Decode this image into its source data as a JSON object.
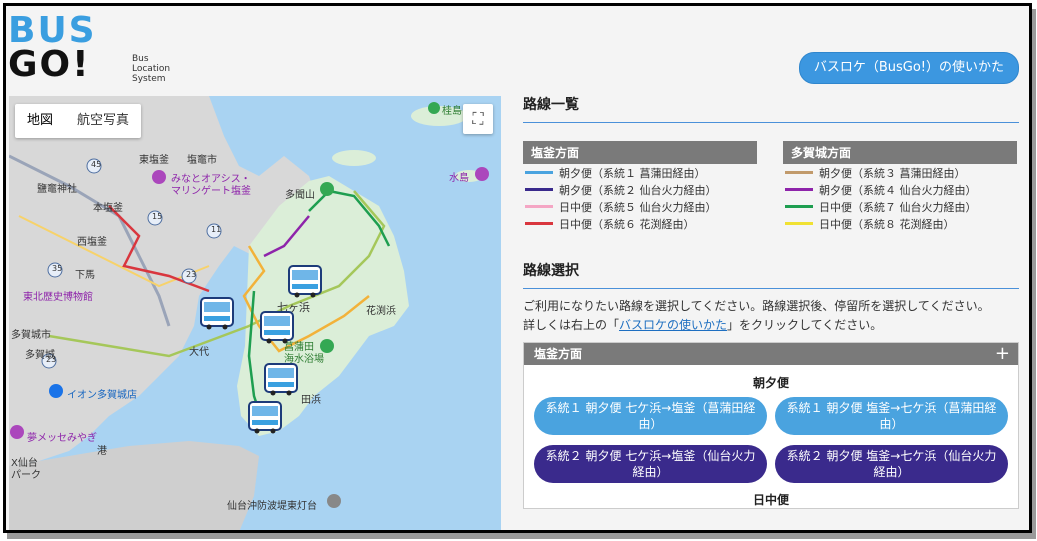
{
  "logo": {
    "big_line1": "BUS",
    "big_line2": "GO!",
    "small": [
      "Bus",
      "Location",
      "System"
    ]
  },
  "header": {
    "help_button": "バスロケ（BusGo!）の使いかた"
  },
  "map": {
    "toggle": [
      "地図",
      "航空写真"
    ],
    "fullscreen_icon": "⛶",
    "labels": {
      "higashishiogama": "東塩釜",
      "shiogamashi": "塩竈市",
      "shiogamajinja": "鹽竈神社",
      "minato_oasis": "みなとオアシス・",
      "marigate": "マリンゲート塩釜",
      "mizushima": "水島",
      "katsurashima": "桂島",
      "tamonzan": "多聞山",
      "honshiogama": "本塩釜",
      "nishishiogama": "西塩釜",
      "shimoma": "下馬",
      "tohoku_museum": "東北歴史博物館",
      "tagajo_city": "多賀城市",
      "tagajo": "多賀城",
      "shichigahama": "七ヶ浜",
      "hanabuchihama": "花渕浜",
      "shobuta": "菖蒲田",
      "kaisuiyokujo": "海水浴場",
      "ohoru": "大代",
      "aeon": "イオン多賀城店",
      "yume_messe": "夢メッセみやぎ",
      "minato": "港",
      "sendaiport": "X仙台",
      "park": "パーク",
      "tahama": "田浜",
      "breakwater": "仙台沖防波堤東灯台",
      "r45": "45",
      "r23a": "23",
      "r23b": "23",
      "r35": "35",
      "r11": "11",
      "r15": "15"
    }
  },
  "route_list": {
    "title": "路線一覧",
    "shiogama": {
      "head": "塩釜方面",
      "items": [
        {
          "label": "朝夕便（系統１ 菖蒲田経由）",
          "color": "#4aa3df"
        },
        {
          "label": "朝夕便（系統２ 仙台火力経由）",
          "color": "#3a2a8c"
        },
        {
          "label": "日中便（系統５ 仙台火力経由）",
          "color": "#f4a6c4"
        },
        {
          "label": "日中便（系統６ 花渕経由）",
          "color": "#d9363e"
        }
      ]
    },
    "tagajo": {
      "head": "多賀城方面",
      "items": [
        {
          "label": "朝夕便（系統３ 菖蒲田経由）",
          "color": "#c19a6b"
        },
        {
          "label": "朝夕便（系統４ 仙台火力経由）",
          "color": "#8e24aa"
        },
        {
          "label": "日中便（系統７ 仙台火力経由）",
          "color": "#1e9e50"
        },
        {
          "label": "日中便（系統８ 花渕経由）",
          "color": "#f0e132"
        }
      ]
    }
  },
  "route_select": {
    "title": "路線選択",
    "desc1": "ご利用になりたい路線を選択してください。路線選択後、停留所を選択してください。",
    "desc2_pre": "詳しくは右上の「",
    "desc2_link": "バスロケの使いかた",
    "desc2_post": "」をクリックしてください。",
    "accordion_head": "塩釜方面",
    "accordion_icon": "+",
    "group1": "朝夕便",
    "buttons": [
      "系統１ 朝夕便 七ケ浜→塩釜（菖蒲田経由）",
      "系統１ 朝夕便 塩釜→七ケ浜（菖蒲田経由）",
      "系統２ 朝夕便 七ケ浜→塩釜（仙台火力経由）",
      "系統２ 朝夕便 塩釜→七ケ浜（仙台火力経由）"
    ],
    "group2": "日中便"
  }
}
